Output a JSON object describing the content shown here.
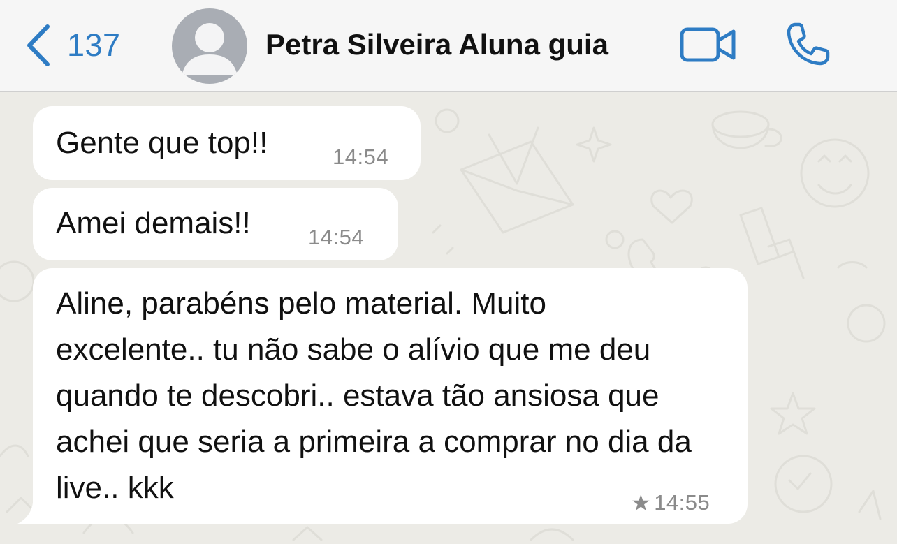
{
  "header": {
    "back_count": "137",
    "contact_name": "Petra Silveira Aluna guia"
  },
  "icons": {
    "back": "chevron-left-icon",
    "avatar": "person-silhouette-icon",
    "video": "video-camera-icon",
    "call": "phone-icon",
    "starred": "star-icon"
  },
  "colors": {
    "accent": "#2e7cc4",
    "header_bg": "#f6f6f6",
    "chat_bg": "#ecebe6",
    "bubble_bg": "#ffffff",
    "timestamp": "#8b8b8b"
  },
  "messages": [
    {
      "text": "Gente que top!!",
      "time": "14:54",
      "starred": false
    },
    {
      "text": "Amei demais!!",
      "time": "14:54",
      "starred": false
    },
    {
      "text": "Aline, parabéns pelo material. Muito excelente.. tu não sabe o alívio que me deu quando te descobri.. estava tão ansiosa que achei que seria a primeira a comprar no dia da live.. kkk",
      "time": "14:55",
      "starred": true
    }
  ]
}
